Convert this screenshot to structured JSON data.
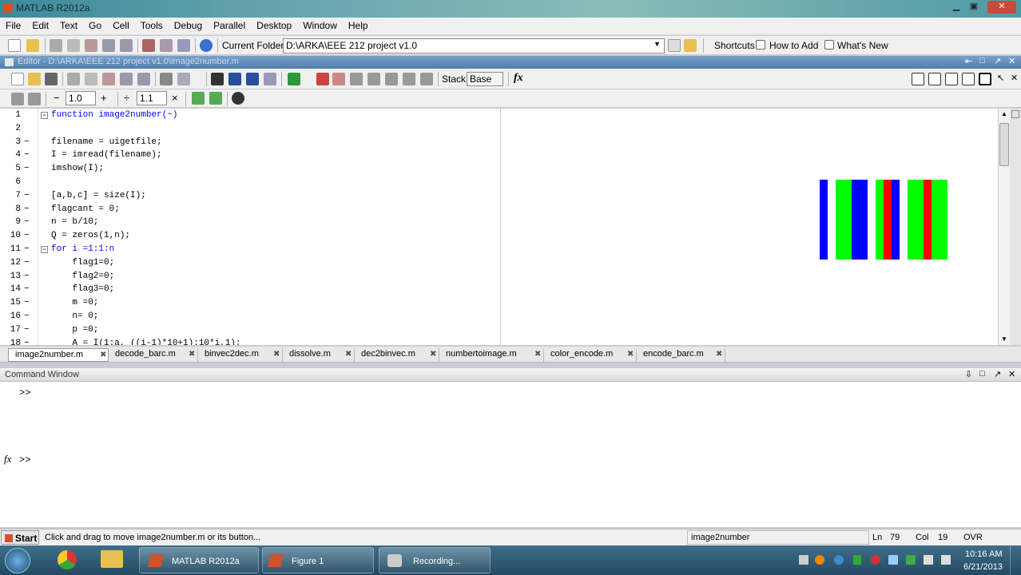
{
  "window": {
    "title": "MATLAB R2012a"
  },
  "menu": [
    "File",
    "Edit",
    "Text",
    "Go",
    "Cell",
    "Tools",
    "Debug",
    "Parallel",
    "Desktop",
    "Window",
    "Help"
  ],
  "main_toolbar": {
    "current_folder_label": "Current Folder:",
    "current_folder_value": "D:\\ARKA\\EEE 212 project v1.0",
    "shortcuts": "Shortcuts",
    "how_to_add": "How to Add",
    "whats_new": "What's New"
  },
  "editor": {
    "title": "Editor - D:\\ARKA\\EEE 212 project v1.0\\image2number.m",
    "stack_label": "Stack:",
    "stack_value": "Base",
    "fx": "fx",
    "cell_minus": "−",
    "cell_value_1": "1.0",
    "cell_plus": "+",
    "cell_divide": "÷",
    "cell_value_2": "1.1",
    "cell_times": "×",
    "lines": [
      {
        "n": "1",
        "dash": "",
        "fold": true,
        "code": "function image2number(~)"
      },
      {
        "n": "2",
        "dash": "",
        "fold": false,
        "code": ""
      },
      {
        "n": "3",
        "dash": "−",
        "fold": false,
        "code": "filename = uigetfile;"
      },
      {
        "n": "4",
        "dash": "−",
        "fold": false,
        "code": "I = imread(filename);"
      },
      {
        "n": "5",
        "dash": "−",
        "fold": false,
        "code": "imshow(I);"
      },
      {
        "n": "6",
        "dash": "",
        "fold": false,
        "code": ""
      },
      {
        "n": "7",
        "dash": "−",
        "fold": false,
        "code": "[a,b,c] = size(I);"
      },
      {
        "n": "8",
        "dash": "−",
        "fold": false,
        "code": "flagcant = 0;"
      },
      {
        "n": "9",
        "dash": "−",
        "fold": false,
        "code": "n = b/10;"
      },
      {
        "n": "10",
        "dash": "−",
        "fold": false,
        "code": "Q = zeros(1,n);"
      },
      {
        "n": "11",
        "dash": "−",
        "fold": true,
        "code": "for i =1:1:n"
      },
      {
        "n": "12",
        "dash": "−",
        "fold": false,
        "code": "    flag1=0;"
      },
      {
        "n": "13",
        "dash": "−",
        "fold": false,
        "code": "    flag2=0;"
      },
      {
        "n": "14",
        "dash": "−",
        "fold": false,
        "code": "    flag3=0;"
      },
      {
        "n": "15",
        "dash": "−",
        "fold": false,
        "code": "    m =0;"
      },
      {
        "n": "16",
        "dash": "−",
        "fold": false,
        "code": "    n= 0;"
      },
      {
        "n": "17",
        "dash": "−",
        "fold": false,
        "code": "    p =0;"
      },
      {
        "n": "18",
        "dash": "−",
        "fold": false,
        "code": "    A = I(1:a, ((i-1)*10+1):10*i,1);"
      }
    ],
    "tabs": [
      "image2number.m",
      "decode_barc.m",
      "binvec2dec.m",
      "dissolve.m",
      "dec2binvec.m",
      "numbertoimage.m",
      "color_encode.m",
      "encode_barc.m"
    ]
  },
  "figure_bars": [
    {
      "color": "#0000ff",
      "w": 10
    },
    {
      "color": "#00ff00",
      "w": 20
    },
    {
      "color": "#0000ff",
      "w": 20
    },
    {
      "color": "#00ff00",
      "w": 10
    },
    {
      "color": "#ff0000",
      "w": 10
    },
    {
      "color": "#0000ff",
      "w": 10
    },
    {
      "color": "#00ff00",
      "w": 20
    },
    {
      "color": "#ff0000",
      "w": 10
    },
    {
      "color": "#00ff00",
      "w": 20
    }
  ],
  "command_window": {
    "title": "Command Window",
    "prompt1": ">>",
    "fx": "fx",
    "prompt2": ">>"
  },
  "statusbar": {
    "start": "Start",
    "message": "Click and drag to move image2number.m or its button...",
    "function": "image2number",
    "ln_label": "Ln",
    "ln": "79",
    "col_label": "Col",
    "col": "19",
    "mode": "OVR"
  },
  "taskbar": {
    "tasks": [
      "MATLAB R2012a",
      "Figure 1",
      "Recording..."
    ],
    "time": "10:16 AM",
    "date": "6/21/2013"
  }
}
